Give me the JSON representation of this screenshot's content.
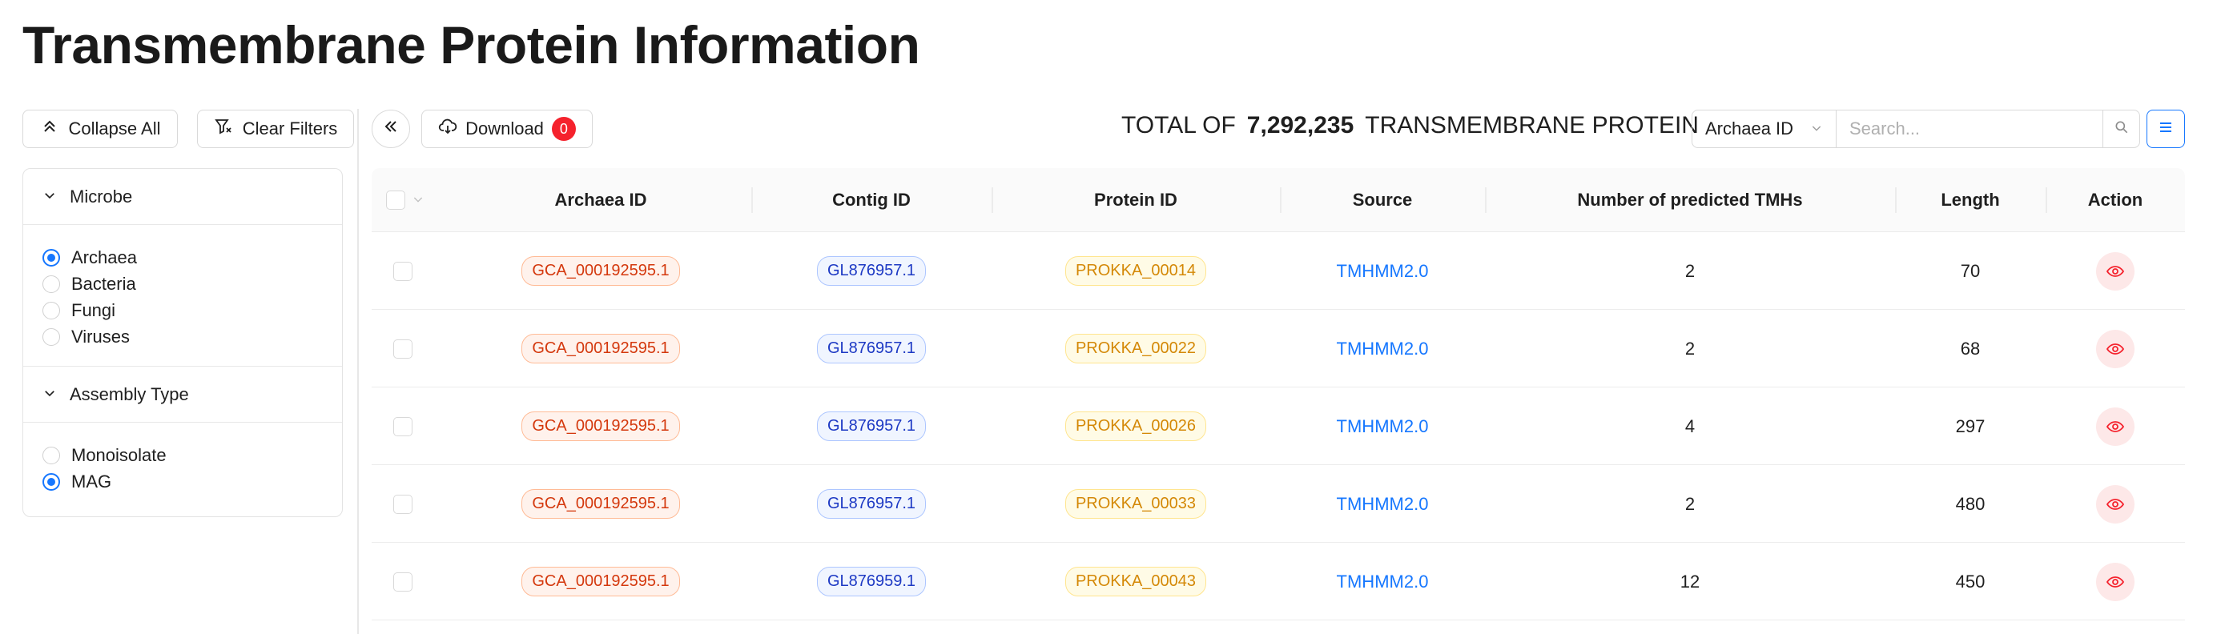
{
  "page": {
    "title": "Transmembrane Protein Information"
  },
  "toolbar": {
    "collapse_all": "Collapse All",
    "clear_filters": "Clear Filters",
    "download": "Download",
    "download_count": "0",
    "total_prefix": "TOTAL OF",
    "total_count": "7,292,235",
    "total_suffix": "TRANSMEMBRANE PROTEIN",
    "search_field": "Archaea ID",
    "search_placeholder": "Search..."
  },
  "filters": {
    "microbe": {
      "title": "Microbe",
      "options": [
        {
          "label": "Archaea",
          "selected": true
        },
        {
          "label": "Bacteria",
          "selected": false
        },
        {
          "label": "Fungi",
          "selected": false
        },
        {
          "label": "Viruses",
          "selected": false
        }
      ]
    },
    "assembly": {
      "title": "Assembly Type",
      "options": [
        {
          "label": "Monoisolate",
          "selected": false
        },
        {
          "label": "MAG",
          "selected": true
        }
      ]
    }
  },
  "table": {
    "columns": [
      "Archaea ID",
      "Contig ID",
      "Protein ID",
      "Source",
      "Number of predicted TMHs",
      "Length",
      "Action"
    ],
    "rows": [
      {
        "archaea_id": "GCA_000192595.1",
        "contig_id": "GL876957.1",
        "protein_id": "PROKKA_00014",
        "source": "TMHMM2.0",
        "tmhs": "2",
        "length": "70"
      },
      {
        "archaea_id": "GCA_000192595.1",
        "contig_id": "GL876957.1",
        "protein_id": "PROKKA_00022",
        "source": "TMHMM2.0",
        "tmhs": "2",
        "length": "68"
      },
      {
        "archaea_id": "GCA_000192595.1",
        "contig_id": "GL876957.1",
        "protein_id": "PROKKA_00026",
        "source": "TMHMM2.0",
        "tmhs": "4",
        "length": "297"
      },
      {
        "archaea_id": "GCA_000192595.1",
        "contig_id": "GL876957.1",
        "protein_id": "PROKKA_00033",
        "source": "TMHMM2.0",
        "tmhs": "2",
        "length": "480"
      },
      {
        "archaea_id": "GCA_000192595.1",
        "contig_id": "GL876959.1",
        "protein_id": "PROKKA_00043",
        "source": "TMHMM2.0",
        "tmhs": "12",
        "length": "450"
      }
    ]
  },
  "colors": {
    "accent": "#1677ff",
    "badge": "#f5222d",
    "archaea_tag": "#d4380d",
    "contig_tag": "#1d39c4",
    "protein_tag": "#d48806",
    "action_icon": "#f5222d"
  },
  "icons": {
    "collapse_all": "double-chevron-up-icon",
    "clear_filters": "filter-clear-icon",
    "collapse_sidebar": "double-chevron-left-icon",
    "download": "cloud-download-icon",
    "section_toggle": "chevron-down-icon",
    "search": "search-icon",
    "menu": "menu-icon",
    "view": "eye-icon"
  }
}
